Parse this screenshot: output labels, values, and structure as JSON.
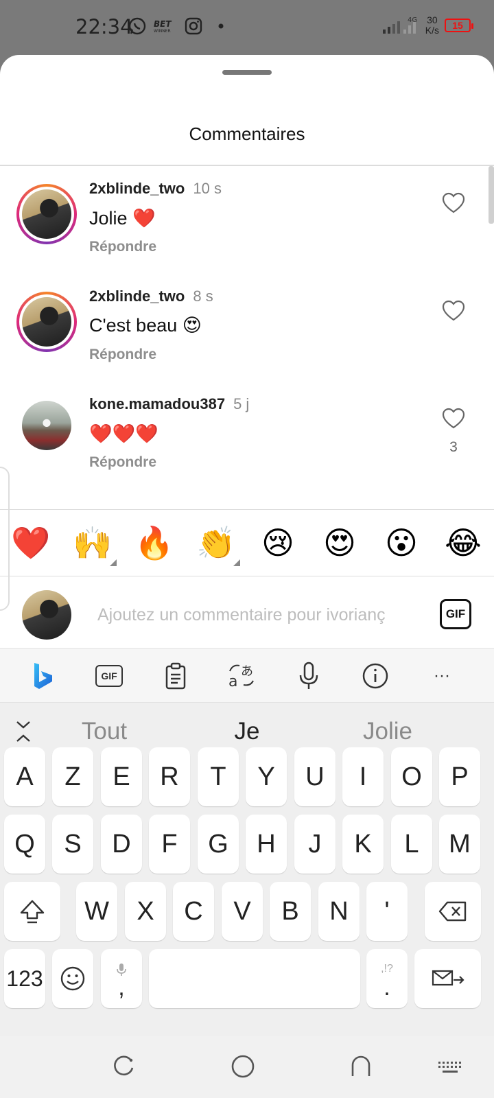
{
  "status_bar": {
    "time": "22:34",
    "network": "4G",
    "speed_value": "30",
    "speed_unit": "K/s",
    "battery": "15",
    "app_icons": [
      "whatsapp-icon",
      "betwinner-icon",
      "instagram-icon",
      "dot-icon"
    ]
  },
  "sheet": {
    "title": "Commentaires"
  },
  "comments": [
    {
      "user": "2xblinde_two",
      "time": "10 s",
      "text": "Jolie ❤️",
      "reply": "Répondre",
      "likes": ""
    },
    {
      "user": "2xblinde_two",
      "time": "8 s",
      "text": "C'est beau 😍",
      "reply": "Répondre",
      "likes": ""
    },
    {
      "user": "kone.mamadou387",
      "time": "5 j",
      "text": "❤️❤️❤️",
      "reply": "Répondre",
      "likes": "3"
    }
  ],
  "emoji_bar": [
    "❤️",
    "🙌",
    "🔥",
    "👏",
    "😢",
    "😍",
    "😮",
    "😂"
  ],
  "comment_input": {
    "placeholder": "Ajoutez un commentaire pour ivorianç",
    "gif_label": "GIF"
  },
  "keyboard": {
    "toolbar": [
      "bing-icon",
      "gif-icon",
      "clipboard-icon",
      "translate-icon",
      "microphone-icon",
      "info-icon",
      "more-icon"
    ],
    "toolbar_gif": "GIF",
    "toolbar_more": "···",
    "suggestions": [
      "Tout",
      "Je",
      "Jolie"
    ],
    "row1": [
      "A",
      "Z",
      "E",
      "R",
      "T",
      "Y",
      "U",
      "I",
      "O",
      "P"
    ],
    "row2": [
      "Q",
      "S",
      "D",
      "F",
      "G",
      "H",
      "J",
      "K",
      "L",
      "M"
    ],
    "row3": [
      "W",
      "X",
      "C",
      "V",
      "B",
      "N",
      "'"
    ],
    "numbers_label": "123",
    "comma_label": ",",
    "period_label": ".",
    "period_hint": ",!?"
  }
}
